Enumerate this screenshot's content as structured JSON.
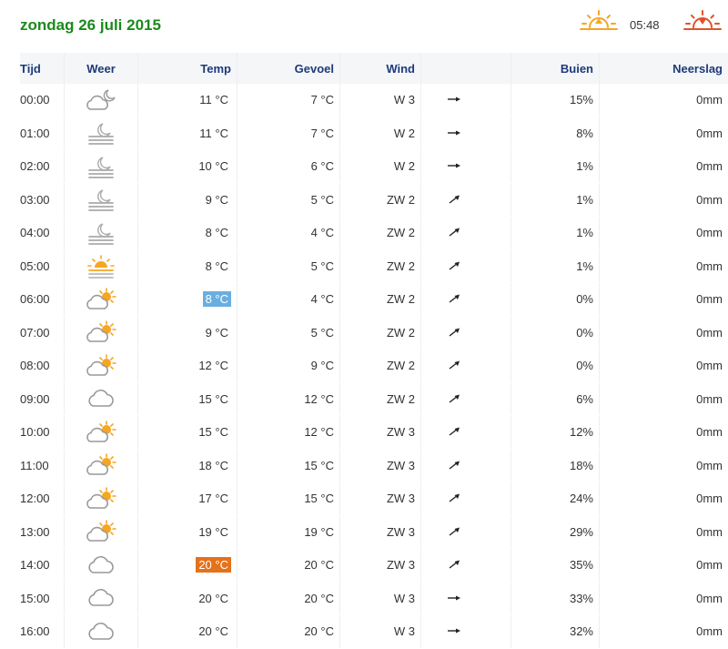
{
  "header": {
    "date_title": "zondag 26 juli 2015",
    "sunrise_icon": "sunrise-icon",
    "sunrise_time": "05:48",
    "sunset_icon": "sunset-icon"
  },
  "table": {
    "columns": [
      "Tijd",
      "Weer",
      "Temp",
      "Gevoel",
      "Wind",
      "",
      "Buien",
      "Neerslag"
    ],
    "rows": [
      {
        "time": "00:00",
        "icon": "night-cloud-moon-icon",
        "temp": "11 °C",
        "feel": "7 °C",
        "wind": "W 3",
        "dir": "E",
        "buien": "15%",
        "neerslag": "0mm"
      },
      {
        "time": "01:00",
        "icon": "night-fog-moon-icon",
        "temp": "11 °C",
        "feel": "7 °C",
        "wind": "W 2",
        "dir": "E",
        "buien": "8%",
        "neerslag": "0mm"
      },
      {
        "time": "02:00",
        "icon": "night-fog-moon-icon",
        "temp": "10 °C",
        "feel": "6 °C",
        "wind": "W 2",
        "dir": "E",
        "buien": "1%",
        "neerslag": "0mm"
      },
      {
        "time": "03:00",
        "icon": "night-fog-moon-icon",
        "temp": "9 °C",
        "feel": "5 °C",
        "wind": "ZW 2",
        "dir": "NE",
        "buien": "1%",
        "neerslag": "0mm"
      },
      {
        "time": "04:00",
        "icon": "night-fog-moon-icon",
        "temp": "8 °C",
        "feel": "4 °C",
        "wind": "ZW 2",
        "dir": "NE",
        "buien": "1%",
        "neerslag": "0mm"
      },
      {
        "time": "05:00",
        "icon": "sunrise-fog-icon",
        "temp": "8 °C",
        "feel": "5 °C",
        "wind": "ZW 2",
        "dir": "NE",
        "buien": "1%",
        "neerslag": "0mm"
      },
      {
        "time": "06:00",
        "icon": "partly-cloudy-sun-icon",
        "temp": "8 °C",
        "temp_style": "cold",
        "feel": "4 °C",
        "wind": "ZW 2",
        "dir": "NE",
        "buien": "0%",
        "neerslag": "0mm"
      },
      {
        "time": "07:00",
        "icon": "partly-cloudy-sun-icon",
        "temp": "9 °C",
        "feel": "5 °C",
        "wind": "ZW 2",
        "dir": "NE",
        "buien": "0%",
        "neerslag": "0mm"
      },
      {
        "time": "08:00",
        "icon": "partly-cloudy-sun-icon",
        "temp": "12 °C",
        "feel": "9 °C",
        "wind": "ZW 2",
        "dir": "NE",
        "buien": "0%",
        "neerslag": "0mm"
      },
      {
        "time": "09:00",
        "icon": "cloud-icon",
        "temp": "15 °C",
        "feel": "12 °C",
        "wind": "ZW 2",
        "dir": "NE",
        "buien": "6%",
        "neerslag": "0mm"
      },
      {
        "time": "10:00",
        "icon": "partly-cloudy-sun-icon",
        "temp": "15 °C",
        "feel": "12 °C",
        "wind": "ZW 3",
        "dir": "NE",
        "buien": "12%",
        "neerslag": "0mm"
      },
      {
        "time": "11:00",
        "icon": "partly-cloudy-sun-icon",
        "temp": "18 °C",
        "feel": "15 °C",
        "wind": "ZW 3",
        "dir": "NE",
        "buien": "18%",
        "neerslag": "0mm"
      },
      {
        "time": "12:00",
        "icon": "partly-cloudy-sun-icon",
        "temp": "17 °C",
        "feel": "15 °C",
        "wind": "ZW 3",
        "dir": "NE",
        "buien": "24%",
        "neerslag": "0mm"
      },
      {
        "time": "13:00",
        "icon": "partly-cloudy-sun-icon",
        "temp": "19 °C",
        "feel": "19 °C",
        "wind": "ZW 3",
        "dir": "NE",
        "buien": "29%",
        "neerslag": "0mm"
      },
      {
        "time": "14:00",
        "icon": "cloud-icon",
        "temp": "20 °C",
        "temp_style": "warm",
        "feel": "20 °C",
        "wind": "ZW 3",
        "dir": "NE",
        "buien": "35%",
        "neerslag": "0mm"
      },
      {
        "time": "15:00",
        "icon": "cloud-icon",
        "temp": "20 °C",
        "feel": "20 °C",
        "wind": "W 3",
        "dir": "E",
        "buien": "33%",
        "neerslag": "0mm"
      },
      {
        "time": "16:00",
        "icon": "cloud-icon",
        "temp": "20 °C",
        "feel": "20 °C",
        "wind": "W 3",
        "dir": "E",
        "buien": "32%",
        "neerslag": "0mm"
      }
    ]
  },
  "colors": {
    "title": "#1a8a1a",
    "header_text": "#1e3a7a",
    "header_bg": "#f5f6f8",
    "cold": "#6aaee0",
    "warm": "#e5711a",
    "sun": "#f5a623",
    "cloud": "#999999"
  }
}
